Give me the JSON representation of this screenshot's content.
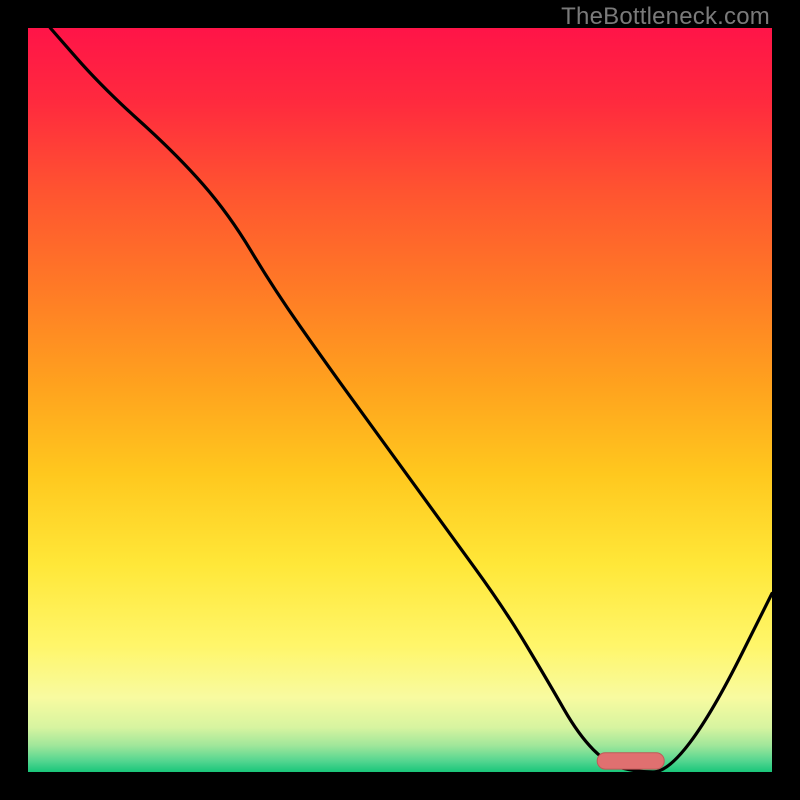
{
  "watermark": "TheBottleneck.com",
  "colors": {
    "background": "#000000",
    "curve": "#000000",
    "marker_fill": "#e07070",
    "marker_stroke": "#c05858",
    "gradient_stops": [
      {
        "offset": 0.0,
        "color": "#ff1448"
      },
      {
        "offset": 0.1,
        "color": "#ff2a3e"
      },
      {
        "offset": 0.22,
        "color": "#ff5430"
      },
      {
        "offset": 0.35,
        "color": "#ff7a26"
      },
      {
        "offset": 0.48,
        "color": "#ffa21e"
      },
      {
        "offset": 0.6,
        "color": "#ffc81e"
      },
      {
        "offset": 0.72,
        "color": "#ffe738"
      },
      {
        "offset": 0.83,
        "color": "#fff66a"
      },
      {
        "offset": 0.9,
        "color": "#f8fba0"
      },
      {
        "offset": 0.94,
        "color": "#d7f4a0"
      },
      {
        "offset": 0.965,
        "color": "#9ee69a"
      },
      {
        "offset": 0.985,
        "color": "#55d690"
      },
      {
        "offset": 1.0,
        "color": "#19c67a"
      }
    ]
  },
  "chart_data": {
    "type": "line",
    "title": "",
    "xlabel": "",
    "ylabel": "",
    "xlim": [
      0,
      100
    ],
    "ylim": [
      0,
      100
    ],
    "x": [
      3,
      10,
      20,
      27,
      33,
      40,
      48,
      56,
      64,
      70,
      74,
      78,
      82,
      86,
      92,
      100
    ],
    "values": [
      100,
      92,
      83,
      75,
      65,
      55,
      44,
      33,
      22,
      12,
      5,
      1,
      0,
      0,
      8,
      24
    ],
    "marker": {
      "x_center": 81,
      "y": 1.5,
      "width": 9,
      "height": 2.2
    }
  }
}
